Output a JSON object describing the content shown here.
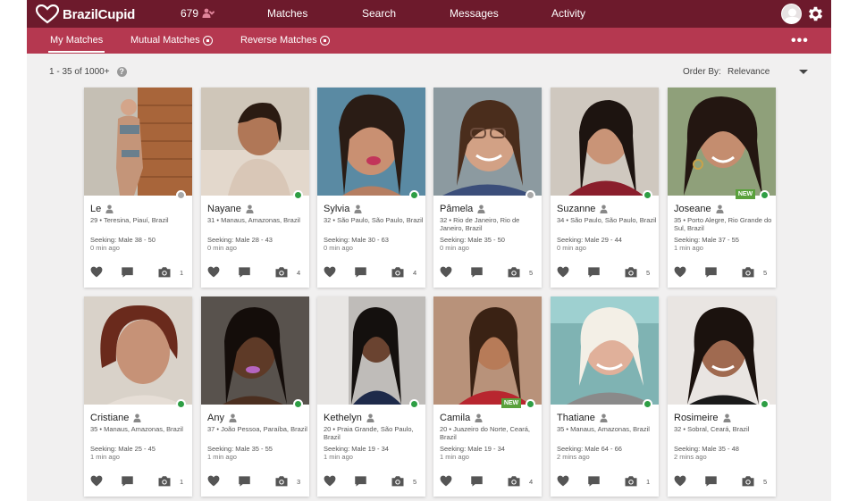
{
  "header": {
    "brand": "BrazilCupid",
    "likes_count": "679",
    "nav": [
      "Matches",
      "Search",
      "Messages",
      "Activity"
    ]
  },
  "subnav": {
    "tabs": [
      "My Matches",
      "Mutual Matches",
      "Reverse Matches"
    ],
    "active": "My Matches"
  },
  "results": {
    "count_text": "1 - 35 of 1000+",
    "order_by_label": "Order By:",
    "order_by_value": "Relevance"
  },
  "colors": {
    "topbar": "#6d1a2c",
    "subbar": "#b53850",
    "online": "#2e9e44",
    "offline": "#a8a8a8",
    "new_badge": "#5aa13c"
  },
  "profiles": [
    {
      "name": "Le",
      "location": "29 • Teresina, Piauí, Brazil",
      "seeking": "Seeking: Male 38 - 50",
      "ago": "0 min ago",
      "online": false,
      "is_new": false,
      "photos": "1"
    },
    {
      "name": "Nayane",
      "location": "31 • Manaus, Amazonas, Brazil",
      "seeking": "Seeking: Male 28 - 43",
      "ago": "0 min ago",
      "online": true,
      "is_new": false,
      "photos": "4"
    },
    {
      "name": "Sylvia",
      "location": "32 • São Paulo, São Paulo, Brazil",
      "seeking": "Seeking: Male 30 - 63",
      "ago": "0 min ago",
      "online": true,
      "is_new": false,
      "photos": "4"
    },
    {
      "name": "Pâmela",
      "location": "32 • Rio de Janeiro, Rio de Janeiro, Brazil",
      "seeking": "Seeking: Male 35 - 50",
      "ago": "0 min ago",
      "online": false,
      "is_new": false,
      "photos": "5"
    },
    {
      "name": "Suzanne",
      "location": "34 • São Paulo, São Paulo, Brazil",
      "seeking": "Seeking: Male 29 - 44",
      "ago": "0 min ago",
      "online": true,
      "is_new": false,
      "photos": "5"
    },
    {
      "name": "Joseane",
      "location": "35 • Porto Alegre, Rio Grande do Sul, Brazil",
      "seeking": "Seeking: Male 37 - 55",
      "ago": "1 min ago",
      "online": true,
      "is_new": true,
      "photos": "5"
    },
    {
      "name": "Cristiane",
      "location": "35 • Manaus, Amazonas, Brazil",
      "seeking": "Seeking: Male 25 - 45",
      "ago": "1 min ago",
      "online": true,
      "is_new": false,
      "photos": "1"
    },
    {
      "name": "Any",
      "location": "37 • João Pessoa, Paraíba, Brazil",
      "seeking": "Seeking: Male 35 - 55",
      "ago": "1 min ago",
      "online": true,
      "is_new": false,
      "photos": "3"
    },
    {
      "name": "Kethelyn",
      "location": "20 • Praia Grande, São Paulo, Brazil",
      "seeking": "Seeking: Male 19 - 34",
      "ago": "1 min ago",
      "online": true,
      "is_new": false,
      "photos": "5"
    },
    {
      "name": "Camila",
      "location": "20 • Juazeiro do Norte, Ceará, Brazil",
      "seeking": "Seeking: Male 19 - 34",
      "ago": "1 min ago",
      "online": true,
      "is_new": true,
      "photos": "4"
    },
    {
      "name": "Thatiane",
      "location": "35 • Manaus, Amazonas, Brazil",
      "seeking": "Seeking: Male 64 - 66",
      "ago": "2 mins ago",
      "online": true,
      "is_new": false,
      "photos": "1"
    },
    {
      "name": "Rosimeire",
      "location": "32 • Sobral, Ceará, Brazil",
      "seeking": "Seeking: Male 35 - 48",
      "ago": "2 mins ago",
      "online": true,
      "is_new": false,
      "photos": "5"
    }
  ]
}
